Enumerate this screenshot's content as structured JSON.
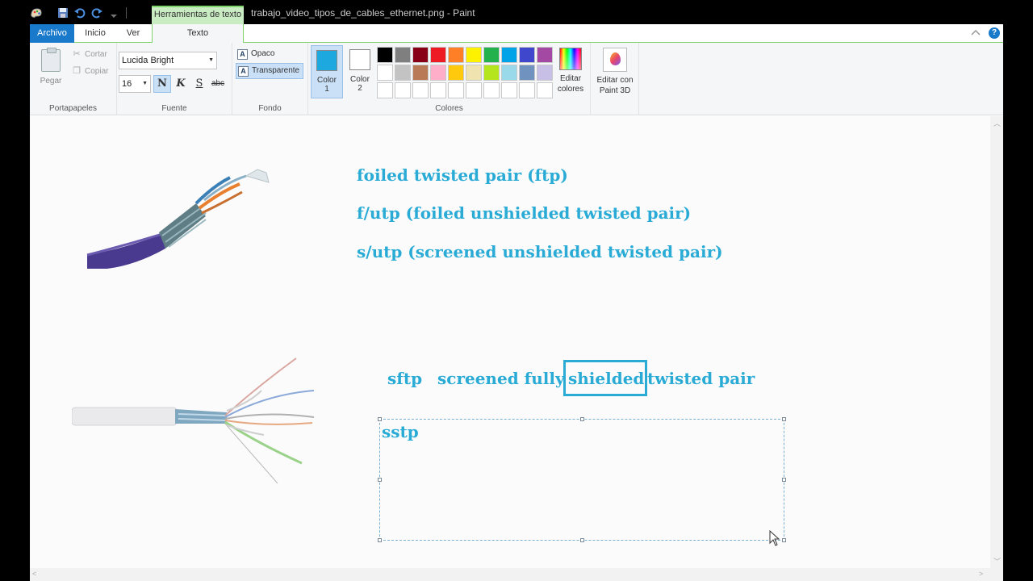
{
  "window": {
    "document_title": "trabajo_video_tipos_de_cables_ethernet.png - Paint",
    "contextual_tab_title": "Herramientas de texto"
  },
  "tabs": {
    "file": "Archivo",
    "home": "Inicio",
    "view": "Ver",
    "text": "Texto"
  },
  "ribbon": {
    "clipboard": {
      "paste": "Pegar",
      "cut": "Cortar",
      "copy": "Copiar",
      "group": "Portapapeles"
    },
    "font": {
      "name": "Lucida Bright",
      "size": "16",
      "bold": "N",
      "italic": "K",
      "underline": "S",
      "strike": "abc",
      "group": "Fuente"
    },
    "background": {
      "opaque": "Opaco",
      "transparent": "Transparente",
      "group": "Fondo"
    },
    "colors": {
      "color1_label": "Color",
      "color1_num": "1",
      "color2_label": "Color",
      "color2_num": "2",
      "color1_value": "#1ea8e0",
      "color2_value": "#ffffff",
      "palette": [
        "#000000",
        "#7f7f7f",
        "#880015",
        "#ed1c24",
        "#ff7f27",
        "#fff200",
        "#22b14c",
        "#00a2e8",
        "#3f48cc",
        "#a349a4",
        "#ffffff",
        "#c3c3c3",
        "#b97a57",
        "#ffaec9",
        "#ffc90e",
        "#efe4b0",
        "#b5e61d",
        "#99d9ea",
        "#7092be",
        "#c8bfe7",
        "#ffffff",
        "#ffffff",
        "#ffffff",
        "#ffffff",
        "#ffffff",
        "#ffffff",
        "#ffffff",
        "#ffffff",
        "#ffffff",
        "#ffffff"
      ],
      "edit_line1": "Editar",
      "edit_line2": "colores",
      "group": "Colores"
    },
    "paint3d": {
      "line1": "Editar con",
      "line2": "Paint 3D"
    }
  },
  "canvas": {
    "line1": "foiled twisted pair (ftp)",
    "line2": "f/utp (foiled unshielded twisted pair)",
    "line3": "s/utp (screened unshielded twisted pair)",
    "sftp": "sftp",
    "screened_fully": "screened fully",
    "shielded": "shielded",
    "twisted_pair": "twisted pair",
    "textbox_text": "sstp",
    "text_color": "#29abd6"
  }
}
